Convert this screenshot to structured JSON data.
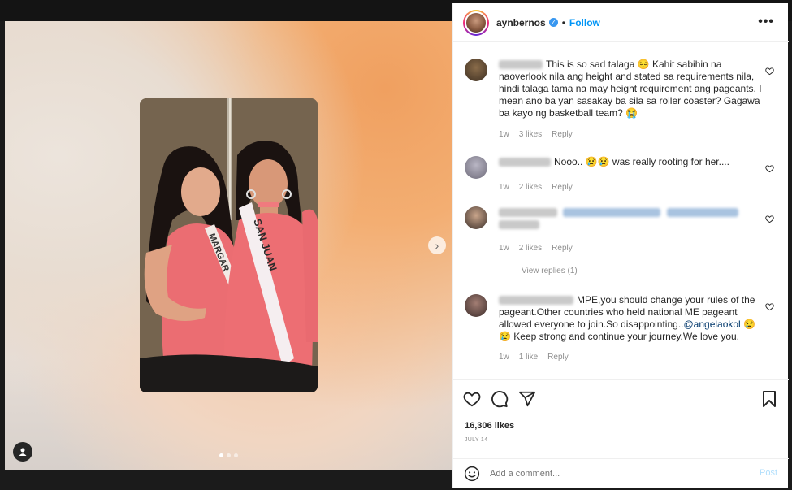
{
  "header": {
    "username": "aynbernos",
    "separator": "•",
    "follow_label": "Follow",
    "more_label": "•••"
  },
  "comments": [
    {
      "text": "This is so sad talaga 😔 Kahit sabihin na naoverlook nila ang height and stated sa requirements nila, hindi talaga tama na may height requirement ang pageants. I mean ano ba yan sasakay ba sila sa roller coaster? Gagawa ba kayo ng basketball team? 😭",
      "time": "1w",
      "likes": "3 likes",
      "reply": "Reply"
    },
    {
      "text": "Nooo.. 😢😢 was really rooting for her....",
      "time": "1w",
      "likes": "2 likes",
      "reply": "Reply"
    },
    {
      "time": "1w",
      "likes": "2 likes",
      "reply": "Reply",
      "view_replies": "View replies (1)"
    },
    {
      "text_before": "MPE,you should change your rules of the pageant.Other countries who held national ME pageant allowed everyone to join.So disappointing..",
      "mention": "@angelaokol",
      "text_after": " 😢😢 Keep strong and continue your journey.We love you.",
      "time": "1w",
      "likes": "1 like",
      "reply": "Reply"
    }
  ],
  "footer": {
    "likes": "16,306 likes",
    "date": "JULY 14",
    "comment_placeholder": "Add a comment...",
    "post_label": "Post"
  },
  "icons": {
    "heart": "heart-icon",
    "comment": "comment-icon",
    "share": "share-icon",
    "bookmark": "bookmark-icon",
    "emoji": "emoji-icon",
    "tag": "user-tag-icon",
    "next": "chevron-right-icon"
  },
  "colors": {
    "link_blue": "#0095f6",
    "text": "#262626",
    "muted": "#8e8e8e",
    "post_disabled": "#b2dffc",
    "mention": "#00376b"
  },
  "carousel": {
    "total_slides": 3,
    "active_slide": 1
  }
}
